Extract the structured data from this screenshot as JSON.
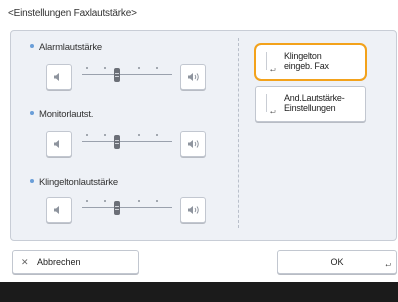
{
  "window": {
    "title": "<Einstellungen Faxlautstärke>"
  },
  "groups": [
    {
      "label": "Alarmlautstärke",
      "level": 0.375
    },
    {
      "label": "Monitorlautst.",
      "level": 0.375
    },
    {
      "label": "Klingeltonlautstärke",
      "level": 0.375
    }
  ],
  "right_buttons": [
    {
      "label_line1": "Klingelton",
      "label_line2": "eingeb. Fax",
      "highlighted": true
    },
    {
      "label_line1": "And.Lautstärke-",
      "label_line2": "Einstellungen",
      "highlighted": false
    }
  ],
  "footer_buttons": {
    "cancel": "Abbrechen",
    "ok": "OK"
  },
  "colors": {
    "highlight": "#f3a21b",
    "accent_dot": "#6a9ed8",
    "footer_bar": "#1b1b1b"
  },
  "icons": {
    "volume_down": "speaker-low-icon",
    "volume_up": "speaker-high-icon",
    "cancel": "close-icon"
  }
}
